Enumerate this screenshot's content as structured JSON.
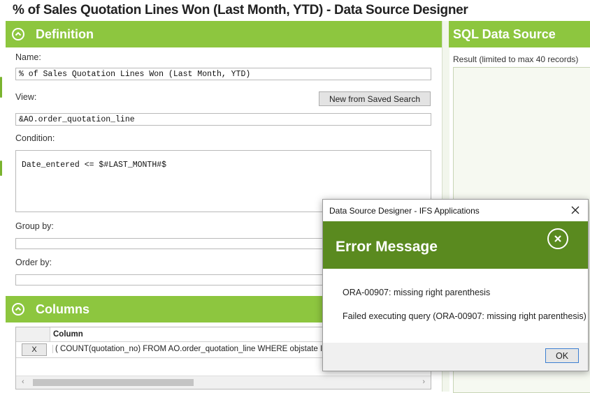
{
  "page_title": "% of Sales Quotation Lines Won (Last Month, YTD) - Data Source Designer",
  "definition": {
    "header": "Definition",
    "name_label": "Name:",
    "name_value": "% of Sales Quotation Lines Won (Last Month, YTD)",
    "view_label": "View:",
    "new_from_saved_search": "New from Saved Search",
    "view_value": "&AO.order_quotation_line",
    "condition_label": "Condition:",
    "condition_value": "Date_entered <=  $#LAST_MONTH#$",
    "group_by_label": "Group by:",
    "group_by_value": "",
    "order_by_label": "Order by:",
    "order_by_value": ""
  },
  "columns": {
    "header": "Columns",
    "column_header": "Column",
    "rows": [
      {
        "remove_label": "X",
        "value": "( COUNT(quotation_no) FROM AO.order_quotation_line WHERE objstate IN ('CO"
      }
    ],
    "scroll_left": "‹",
    "scroll_right": "›"
  },
  "sql": {
    "header": "SQL Data Source",
    "result_label": "Result (limited to max 40 records)"
  },
  "dialog": {
    "title": "Data Source Designer - IFS Applications",
    "heading": "Error Message",
    "message_1": "ORA-00907: missing right parenthesis",
    "message_2": "Failed executing query (ORA-00907: missing right parenthesis)",
    "ok_label": "OK"
  },
  "colors": {
    "accent_green": "#8dc63f",
    "dialog_banner": "#5a8a1f"
  }
}
